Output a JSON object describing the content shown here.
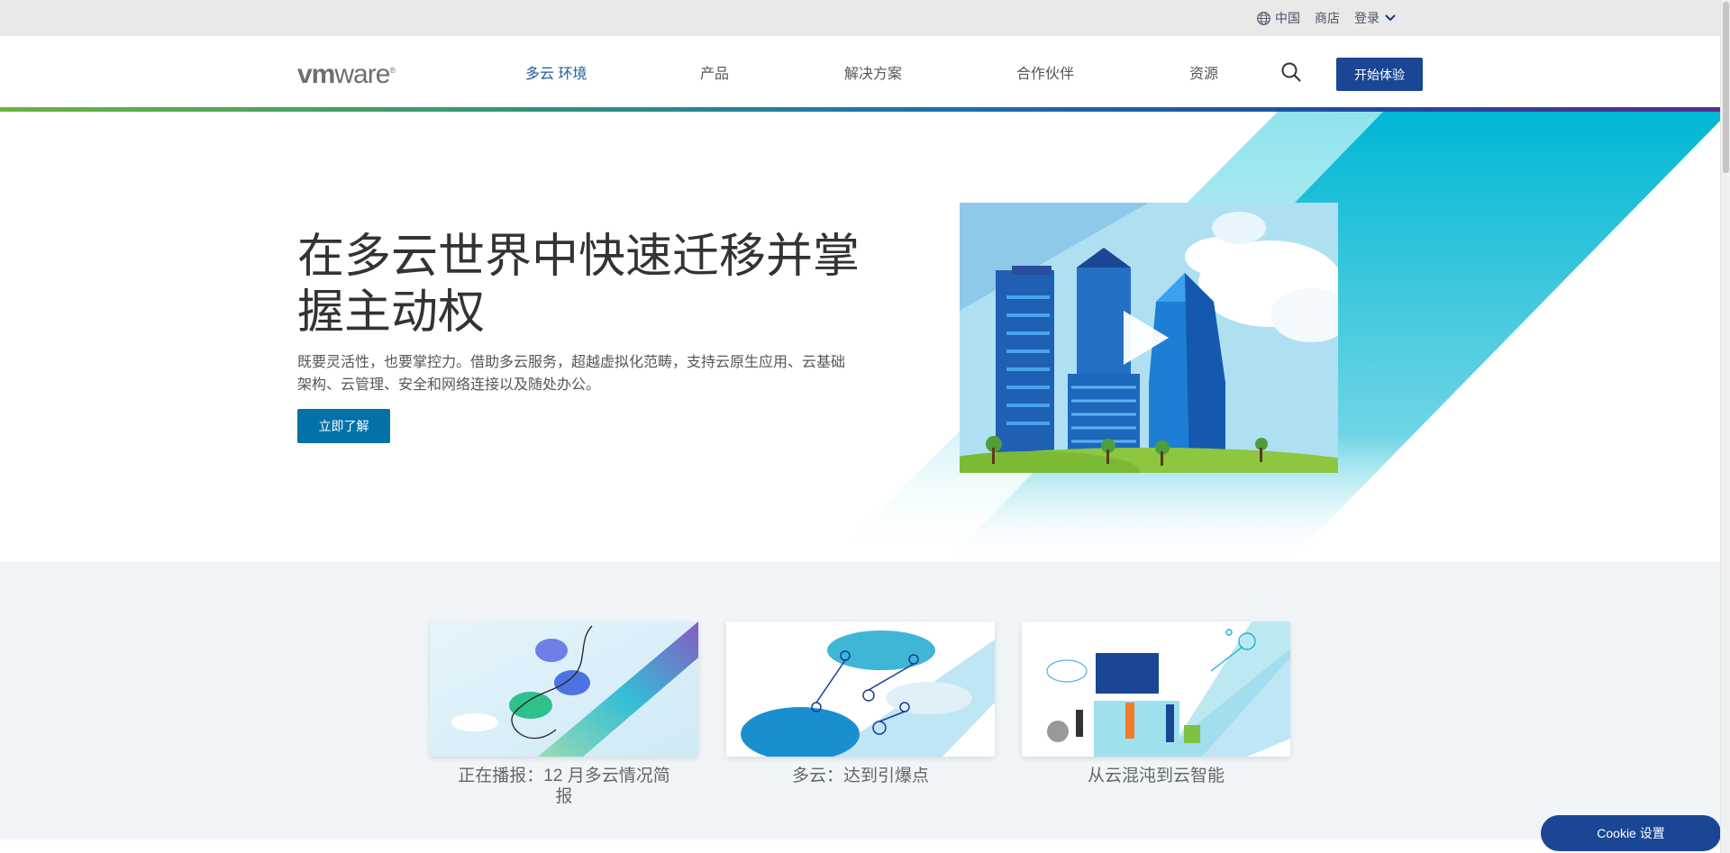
{
  "utility": {
    "region": "中国",
    "store": "商店",
    "login": "登录"
  },
  "header": {
    "logo": {
      "vm": "vm",
      "ware": "ware",
      "mark": "®"
    },
    "nav": [
      {
        "label": "多云 环境",
        "active": true
      },
      {
        "label": "产品"
      },
      {
        "label": "解决方案"
      },
      {
        "label": "合作伙伴"
      },
      {
        "label": "资源"
      }
    ],
    "cta": "开始体验"
  },
  "hero": {
    "title": "在多云世界中快速迁移并掌握主动权",
    "description": "既要灵活性，也要掌控力。借助多云服务，超越虚拟化范畴，支持云原生应用、云基础架构、云管理、安全和网络连接以及随处办公。",
    "button": "立即了解",
    "video_icon": "play-icon"
  },
  "cards": [
    {
      "title": "正在播报：12 月多云情况简报"
    },
    {
      "title": "多云：达到引爆点"
    },
    {
      "title": "从云混沌到云智能"
    }
  ],
  "cookie": {
    "label": "Cookie 设置"
  },
  "colors": {
    "brand_blue": "#1a4694",
    "cta_blue": "#0072a8",
    "teal": "#00b7d4",
    "green": "#6cb33f",
    "section_bg": "#f1f5f8"
  }
}
